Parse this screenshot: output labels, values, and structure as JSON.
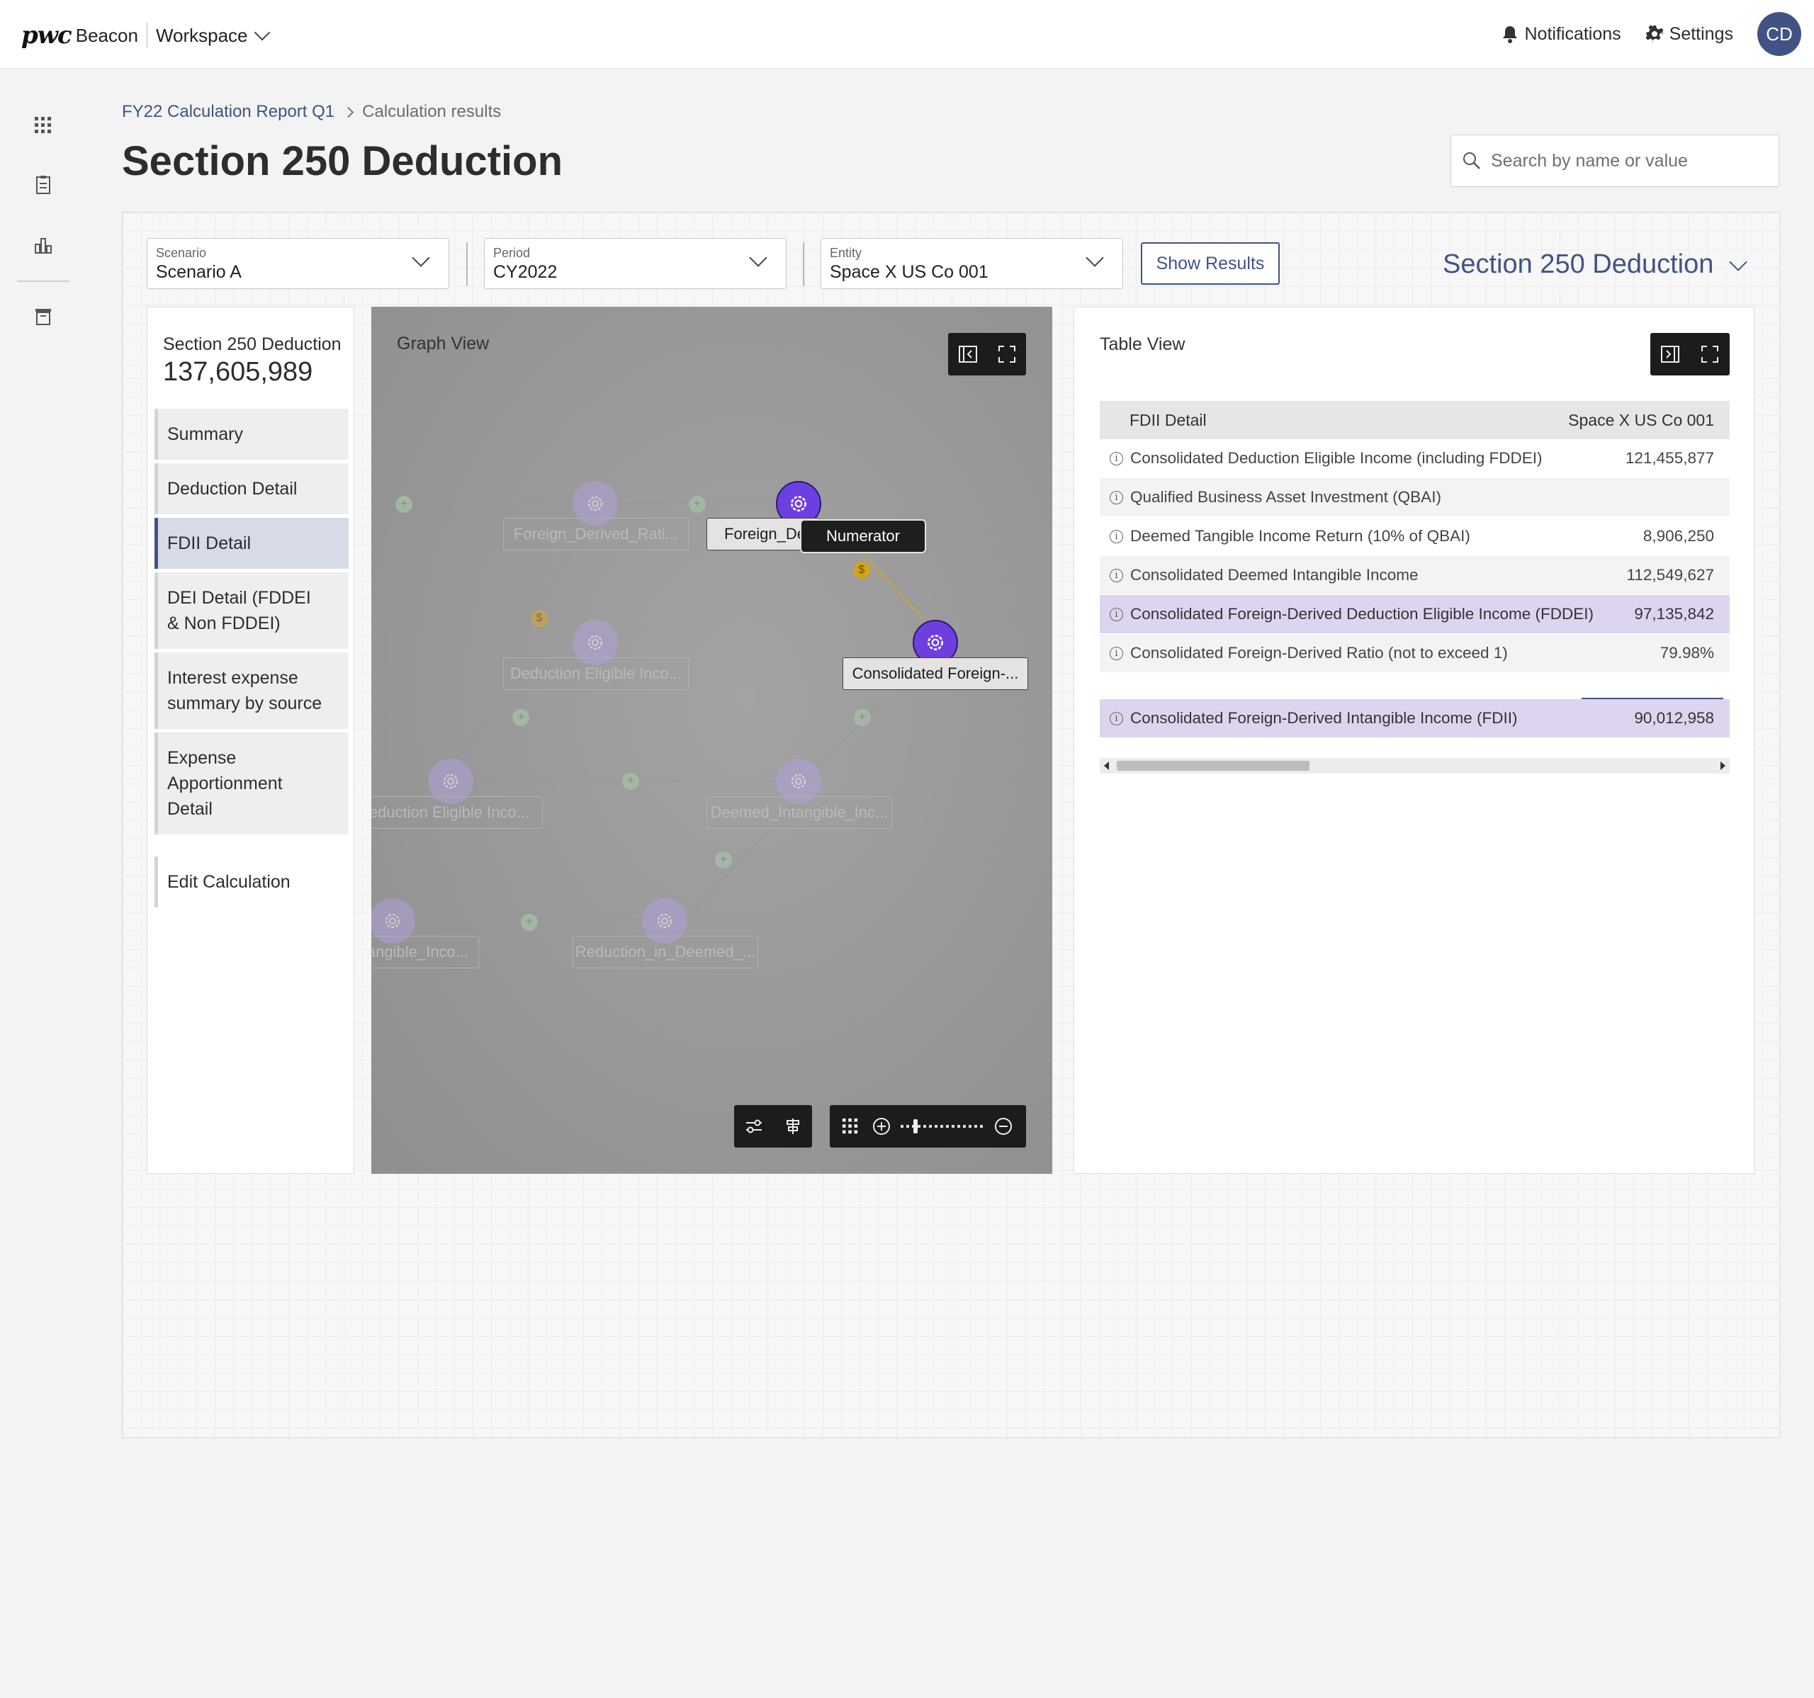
{
  "app": {
    "brand": "pwc",
    "product": "Beacon",
    "workspace_label": "Workspace",
    "notifications_label": "Notifications",
    "settings_label": "Settings",
    "user_initials": "CD"
  },
  "breadcrumb": {
    "parent": "FY22 Calculation Report Q1",
    "current": "Calculation results"
  },
  "page_title": "Section 250 Deduction",
  "search": {
    "placeholder": "Search by name or value"
  },
  "filters": {
    "scenario": {
      "label": "Scenario",
      "value": "Scenario A"
    },
    "period": {
      "label": "Period",
      "value": "CY2022"
    },
    "entity": {
      "label": "Entity",
      "value": "Space X US Co 001"
    },
    "show_results_label": "Show Results",
    "calculation_select": "Section 250 Deduction"
  },
  "nav_panel": {
    "title": "Section 250 Deduction",
    "value": "137,605,989",
    "items": [
      {
        "label": "Summary"
      },
      {
        "label": "Deduction Detail"
      },
      {
        "label": "FDII Detail"
      },
      {
        "label": "DEI Detail (FDDEI & Non FDDEI)"
      },
      {
        "label": "Interest expense summary by source"
      },
      {
        "label": "Expense Apportionment Detail"
      },
      {
        "label": "Edit Calculation"
      }
    ],
    "active_item": "FDII Detail"
  },
  "graph": {
    "title": "Graph View",
    "tooltip": "Numerator",
    "nodes": [
      {
        "label": "Foreign_Derived_Rati...",
        "state": "faded"
      },
      {
        "label": "Foreign_De",
        "state": "active"
      },
      {
        "label": "Consolidated Foreign-...",
        "state": "active"
      },
      {
        "label": "Deduction Eligible Inco...",
        "state": "faded"
      },
      {
        "label": "Deduction Eligible Inco...",
        "state": "faded"
      },
      {
        "label": "Deemed_Intangible_Inc...",
        "state": "faded"
      },
      {
        "label": "angible_Inco...",
        "state": "faded"
      },
      {
        "label": "Reduction_in_Deemed_...",
        "state": "faded"
      }
    ]
  },
  "table": {
    "title": "Table View",
    "header": {
      "col1": "FDII Detail",
      "col2": "Space X US Co 001"
    },
    "rows": [
      {
        "label": "Consolidated Deduction Eligible Income (including FDDEI)",
        "value": "121,455,877"
      },
      {
        "label": "Qualified Business Asset Investment (QBAI)",
        "value": ""
      },
      {
        "label": "Deemed Tangible Income Return (10% of QBAI)",
        "value": "8,906,250"
      },
      {
        "label": "Consolidated Deemed Intangible Income",
        "value": "112,549,627"
      },
      {
        "label": "Consolidated Foreign-Derived Deduction Eligible Income (FDDEI)",
        "value": "97,135,842"
      },
      {
        "label": "Consolidated Foreign-Derived  Ratio (not to exceed 1)",
        "value": "79.98%"
      },
      {
        "label": "Consolidated Foreign-Derived Intangible Income (FDII)",
        "value": "90,012,958"
      }
    ]
  },
  "colors": {
    "brand_blue": "#415385",
    "active_node": "#6e3fe0",
    "highlight_row": "#ddd5f0"
  },
  "icons": [
    "bell-icon",
    "gear-icon",
    "search-icon",
    "apps-grid-icon",
    "report-icon",
    "chart-icon",
    "archive-icon",
    "collapse-panel-icon",
    "expand-icon",
    "filter-icon",
    "list-icon",
    "zoom-in-icon",
    "zoom-out-icon"
  ]
}
